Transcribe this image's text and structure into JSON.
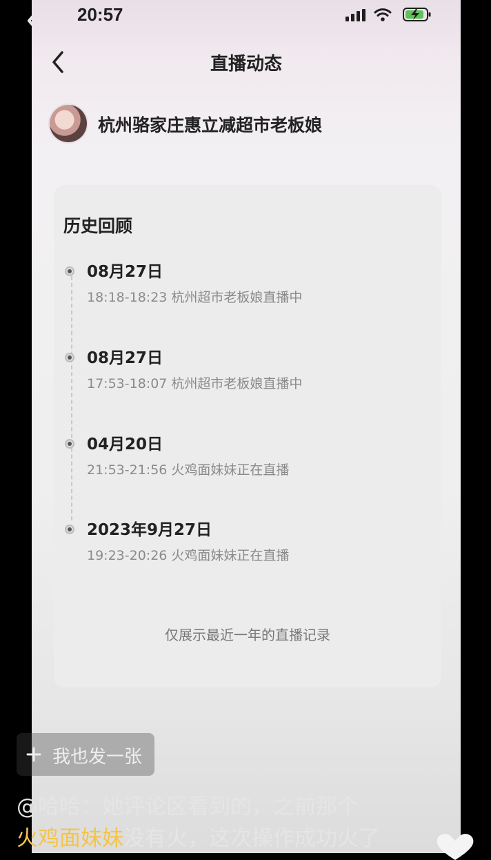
{
  "status_bar": {
    "time": "20:57"
  },
  "nav": {
    "title": "直播动态"
  },
  "profile": {
    "name": "杭州骆家庄惠立减超市老板娘"
  },
  "history": {
    "heading": "历史回顾",
    "entries": [
      {
        "date": "08月27日",
        "detail": "18:18-18:23 杭州超市老板娘直播中"
      },
      {
        "date": "08月27日",
        "detail": "17:53-18:07 杭州超市老板娘直播中"
      },
      {
        "date": "04月20日",
        "detail": "21:53-21:56 火鸡面妹妹正在直播"
      },
      {
        "date": "2023年9月27日",
        "detail": "19:23-20:26 火鸡面妹妹正在直播"
      }
    ],
    "footer": "仅展示最近一年的直播记录"
  },
  "overlay": {
    "add_label": "我也发一张",
    "caption_line1": "@哈哈：她评论区看到的，之前那个",
    "caption_highlight": "火鸡面妹妹",
    "caption_line2_rest": "没有火，这次操作成功火了"
  },
  "colors": {
    "highlight": "#f3c44a",
    "card_bg": "#ececec"
  }
}
